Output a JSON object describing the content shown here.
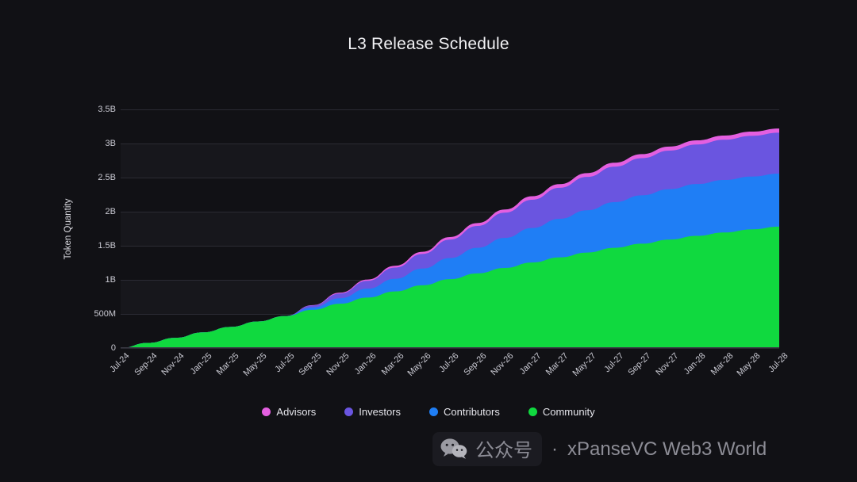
{
  "page": {
    "background": "#111115",
    "title": "L3 Release Schedule"
  },
  "watermark": {
    "icon": "wechat-icon",
    "label": "公众号",
    "separator": "·",
    "brand": "xPanseVC Web3 World"
  },
  "legend": {
    "position": "bottom-center",
    "items": [
      {
        "label": "Advisors",
        "color": "#e45fe0"
      },
      {
        "label": "Investors",
        "color": "#6a55e0"
      },
      {
        "label": "Contributors",
        "color": "#1f7ef5"
      },
      {
        "label": "Community",
        "color": "#10d93f"
      }
    ]
  },
  "chart_data": {
    "type": "area",
    "stacked": true,
    "title": "L3 Release Schedule",
    "xlabel": "",
    "ylabel": "Token Quantity",
    "ylim": [
      0,
      3500000000
    ],
    "ytick_labels": [
      "0",
      "500M",
      "1B",
      "1.5B",
      "2B",
      "2.5B",
      "3B",
      "3.5B"
    ],
    "ytick_values": [
      0,
      500000000,
      1000000000,
      1500000000,
      2000000000,
      2500000000,
      3000000000,
      3500000000
    ],
    "grid": true,
    "alternating_bands": true,
    "legend_position": "bottom",
    "categories": [
      "Jul-24",
      "Sep-24",
      "Nov-24",
      "Jan-25",
      "Mar-25",
      "May-25",
      "Jul-25",
      "Sep-25",
      "Nov-25",
      "Jan-26",
      "Mar-26",
      "May-26",
      "Jul-26",
      "Sep-26",
      "Nov-26",
      "Jan-27",
      "Mar-27",
      "May-27",
      "Jul-27",
      "Sep-27",
      "Nov-27",
      "Jan-28",
      "Mar-28",
      "May-28",
      "Jul-28"
    ],
    "series": [
      {
        "name": "Community",
        "color": "#10d93f",
        "values": [
          0,
          75000000,
          150000000,
          230000000,
          310000000,
          390000000,
          470000000,
          560000000,
          650000000,
          740000000,
          830000000,
          920000000,
          1010000000,
          1095000000,
          1175000000,
          1255000000,
          1330000000,
          1400000000,
          1470000000,
          1530000000,
          1590000000,
          1645000000,
          1695000000,
          1740000000,
          1780000000
        ]
      },
      {
        "name": "Contributors",
        "color": "#1f7ef5",
        "values": [
          0,
          0,
          0,
          0,
          0,
          0,
          0,
          35000000,
          80000000,
          130000000,
          185000000,
          245000000,
          310000000,
          375000000,
          440000000,
          505000000,
          565000000,
          620000000,
          670000000,
          710000000,
          740000000,
          760000000,
          770000000,
          775000000,
          778000000
        ]
      },
      {
        "name": "Investors",
        "color": "#6a55e0",
        "values": [
          0,
          0,
          0,
          0,
          0,
          0,
          0,
          30000000,
          70000000,
          115000000,
          165000000,
          215000000,
          270000000,
          320000000,
          370000000,
          415000000,
          455000000,
          490000000,
          520000000,
          545000000,
          565000000,
          580000000,
          590000000,
          597000000,
          600000000
        ]
      },
      {
        "name": "Advisors",
        "color": "#e45fe0",
        "values": [
          0,
          0,
          0,
          0,
          0,
          0,
          0,
          5000000,
          12000000,
          19000000,
          26000000,
          32000000,
          38000000,
          43000000,
          47000000,
          51000000,
          54000000,
          56000000,
          58000000,
          59000000,
          60000000,
          61000000,
          62000000,
          62000000,
          62000000
        ]
      }
    ],
    "stack_totals": [
      0,
      75000000,
      150000000,
      230000000,
      310000000,
      390000000,
      470000000,
      630000000,
      812000000,
      1004000000,
      1206000000,
      1412000000,
      1628000000,
      1833000000,
      2032000000,
      2226000000,
      2404000000,
      2566000000,
      2718000000,
      2844000000,
      2955000000,
      3046000000,
      3117000000,
      3174000000,
      3220000000
    ]
  }
}
